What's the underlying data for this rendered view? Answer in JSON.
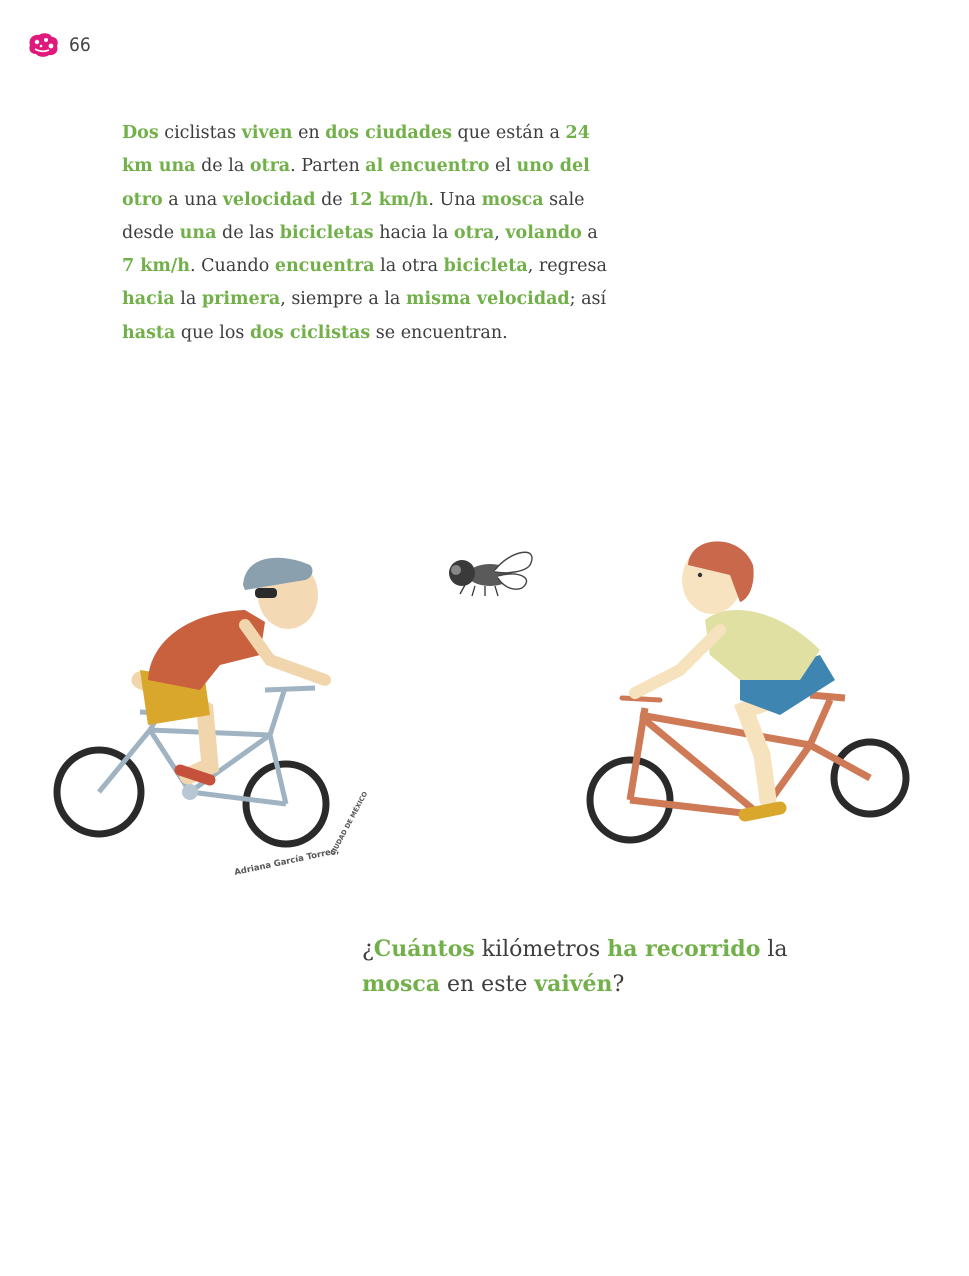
{
  "header": {
    "page_number": "66",
    "logo_icon": "mexico-book-logo-icon",
    "logo_color": "#e0197d"
  },
  "colors": {
    "highlight": "#72b04a",
    "text": "#3d3d3d"
  },
  "problem": {
    "lines": [
      [
        [
          "Dos",
          true
        ],
        [
          " ciclistas ",
          false
        ],
        [
          "viven",
          true
        ],
        [
          " en ",
          false
        ],
        [
          "dos ciudades",
          true
        ],
        [
          " que están a ",
          false
        ],
        [
          "24",
          true
        ]
      ],
      [
        [
          "km una",
          true
        ],
        [
          " de la ",
          false
        ],
        [
          "otra",
          true
        ],
        [
          ". Parten ",
          false
        ],
        [
          "al encuentro",
          true
        ],
        [
          " el ",
          false
        ],
        [
          "uno del",
          true
        ]
      ],
      [
        [
          "otro",
          true
        ],
        [
          " a una ",
          false
        ],
        [
          "velocidad",
          true
        ],
        [
          " de ",
          false
        ],
        [
          "12 km/h",
          true
        ],
        [
          ". Una ",
          false
        ],
        [
          "mosca",
          true
        ],
        [
          " sale",
          false
        ]
      ],
      [
        [
          "desde ",
          false
        ],
        [
          "una",
          true
        ],
        [
          " de las ",
          false
        ],
        [
          "bicicletas",
          true
        ],
        [
          " hacia la ",
          false
        ],
        [
          "otra",
          true
        ],
        [
          ", ",
          false
        ],
        [
          "volando",
          true
        ],
        [
          " a",
          false
        ]
      ],
      [
        [
          "7 km/h",
          true
        ],
        [
          ". Cuando ",
          false
        ],
        [
          "encuentra",
          true
        ],
        [
          " la otra ",
          false
        ],
        [
          "bicicleta",
          true
        ],
        [
          ", regresa",
          false
        ]
      ],
      [
        [
          "hacia",
          true
        ],
        [
          " la ",
          false
        ],
        [
          "primera",
          true
        ],
        [
          ", siempre a la ",
          false
        ],
        [
          "misma velocidad",
          true
        ],
        [
          "; así",
          false
        ]
      ],
      [
        [
          "hasta",
          true
        ],
        [
          " que los ",
          false
        ],
        [
          "dos ciclistas",
          true
        ],
        [
          " se encuentran.",
          false
        ]
      ]
    ]
  },
  "illustration": {
    "left_cyclist": "cyclist-blue-bike-illustration",
    "fly": "fly-illustration",
    "right_cyclist": "cyclist-red-bike-illustration",
    "credit_name": "Adriana García Torres,",
    "credit_place": "CIUDAD DE MÉXICO"
  },
  "question": {
    "lines": [
      [
        [
          "¿",
          false
        ],
        [
          "Cuántos",
          true
        ],
        [
          " kilómetros ",
          false
        ],
        [
          "ha recorrido",
          true
        ],
        [
          " la",
          false
        ]
      ],
      [
        [
          "mosca",
          true
        ],
        [
          " en este ",
          false
        ],
        [
          "vaivén",
          true
        ],
        [
          "?",
          false
        ]
      ]
    ]
  }
}
